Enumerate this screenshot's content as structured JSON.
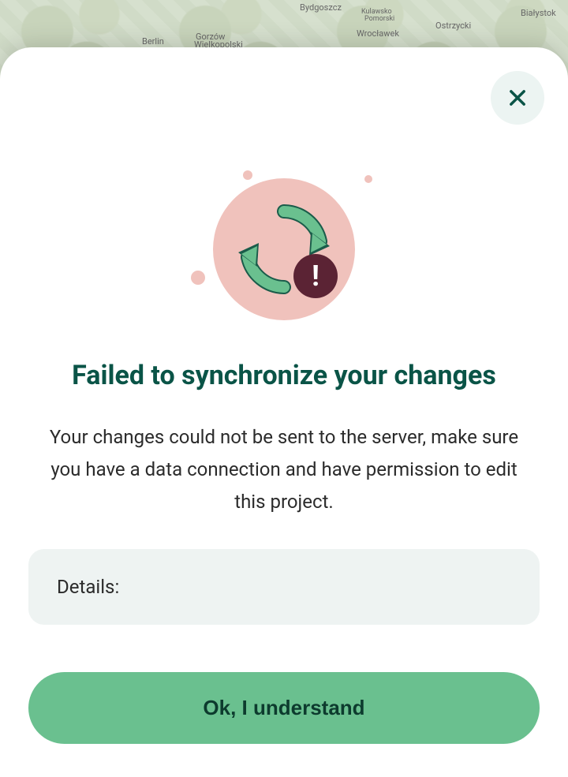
{
  "map": {
    "labels": [
      "Berlin",
      "Gorzów",
      "Wielkopolski",
      "Bydgoszcz",
      "Wrocławek",
      "Ostrzycki",
      "Kulawsko",
      "Pomorski",
      "Białystok"
    ]
  },
  "modal": {
    "title": "Failed to synchronize your changes",
    "message": "Your changes could not be sent to the server, make sure you have a data connection and have permission to edit this project.",
    "details_label": "Details:",
    "details_content": "",
    "primary_button": "Ok, I understand"
  }
}
